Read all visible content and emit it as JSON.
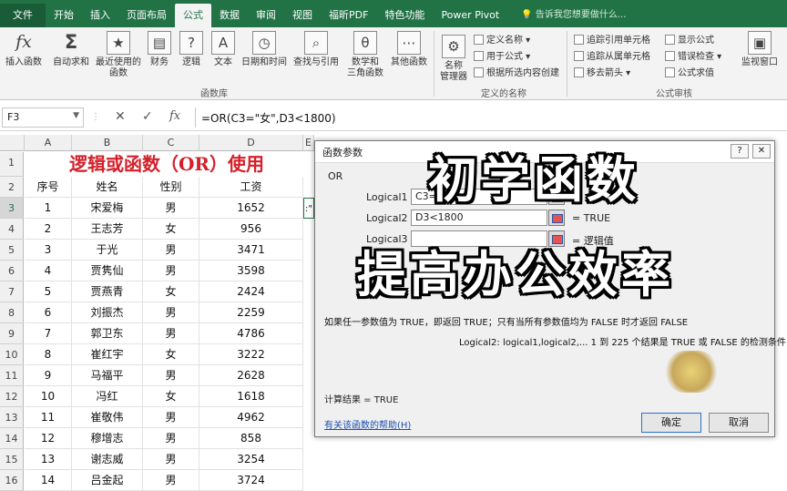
{
  "ribbon": {
    "tabs": [
      "文件",
      "开始",
      "插入",
      "页面布局",
      "公式",
      "数据",
      "审阅",
      "视图",
      "福昕PDF",
      "特色功能",
      "Power Pivot"
    ],
    "active_tab": "公式",
    "search_placeholder": "告诉我您想要做什么...",
    "buttons": {
      "insert_function": "插入函数",
      "autosum": "自动求和",
      "recent_line1": "最近使用的",
      "recent_line2": "函数",
      "financial": "财务",
      "logical": "逻辑",
      "text": "文本",
      "datetime": "日期和时间",
      "lookup": "查找与引用",
      "math_line1": "数学和",
      "math_line2": "三角函数",
      "other": "其他函数",
      "name_manager_line1": "名称",
      "name_manager_line2": "管理器",
      "define_name": "定义名称",
      "use_in_formula": "用于公式",
      "create_from_selection": "根据所选内容创建",
      "trace_precedents": "追踪引用单元格",
      "trace_dependents": "追踪从属单元格",
      "remove_arrows": "移去箭头",
      "show_formulas": "显示公式",
      "error_checking": "错误检查",
      "evaluate_formula": "公式求值",
      "watch_window": "监视窗口"
    },
    "groups": {
      "function_library": "函数库",
      "defined_names": "定义的名称",
      "formula_auditing": "公式审核"
    }
  },
  "formula_bar": {
    "name_box": "F3",
    "formula": "=OR(C3=\"女\",D3<1800)"
  },
  "sheet": {
    "columns": [
      "A",
      "B",
      "C",
      "D",
      "E"
    ],
    "rows": [
      "1",
      "2",
      "3",
      "4",
      "5",
      "6",
      "7",
      "8",
      "9",
      "10",
      "11",
      "12",
      "13",
      "14",
      "15",
      "16"
    ],
    "title": "逻辑或函数（OR）使用",
    "headers": [
      "序号",
      "姓名",
      "性别",
      "工资"
    ],
    "data": [
      [
        "1",
        "宋爱梅",
        "男",
        "1652"
      ],
      [
        "2",
        "王志芳",
        "女",
        "956"
      ],
      [
        "3",
        "于光",
        "男",
        "3471"
      ],
      [
        "4",
        "贾隽仙",
        "男",
        "3598"
      ],
      [
        "5",
        "贾燕青",
        "女",
        "2424"
      ],
      [
        "6",
        "刘振杰",
        "男",
        "2259"
      ],
      [
        "7",
        "郭卫东",
        "男",
        "4786"
      ],
      [
        "8",
        "崔红宇",
        "女",
        "3222"
      ],
      [
        "9",
        "马福平",
        "男",
        "2628"
      ],
      [
        "10",
        "冯红",
        "女",
        "1618"
      ],
      [
        "11",
        "崔敬伟",
        "男",
        "4962"
      ],
      [
        "12",
        "穆增志",
        "男",
        "858"
      ],
      [
        "13",
        "谢志威",
        "男",
        "3254"
      ],
      [
        "14",
        "吕金起",
        "男",
        "3724"
      ]
    ],
    "e3_partial": ":\""
  },
  "dialog": {
    "title": "函数参数",
    "help_btn": "?",
    "close_btn": "✕",
    "function_name": "OR",
    "args": [
      {
        "label": "Logical1",
        "value": "C3=",
        "result": ""
      },
      {
        "label": "Logical2",
        "value": "D3<1800",
        "result": "=  TRUE"
      },
      {
        "label": "Logical3",
        "value": "",
        "result": "=  逻辑值"
      }
    ],
    "description": "如果任一参数值为 TRUE，即返回 TRUE；只有当所有参数值均为 FALSE 时才返回 FALSE",
    "arg_description": "Logical2:  logical1,logical2,... 1 到 225 个结果是 TRUE 或 FALSE 的检测条件",
    "result": "计算结果 =   TRUE",
    "help_link": "有关该函数的帮助(H)",
    "ok": "确定",
    "cancel": "取消"
  },
  "overlay": {
    "line1": "初学函数",
    "line2": "提高办公效率"
  }
}
